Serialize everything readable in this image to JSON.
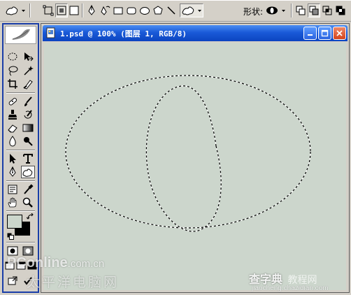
{
  "options_bar": {
    "shape_label": "形状:"
  },
  "document": {
    "title": "1.psd @ 100% (图层 1, RGB/8)"
  },
  "colors": {
    "toolbox_border": "#1a3ea8",
    "titlebar": "#1a5ad8",
    "canvas": "#ccd6cc",
    "foreground_color": "#ccd6cc",
    "background_color": "#000000"
  },
  "watermarks": {
    "left_brand": "PConline",
    "left_domain": ".com.cn",
    "left_cn": "太平洋电脑网",
    "right_cn": "查字典",
    "right_sub": "教程网",
    "right_domain": "jiaocheng.chazidian.com"
  }
}
